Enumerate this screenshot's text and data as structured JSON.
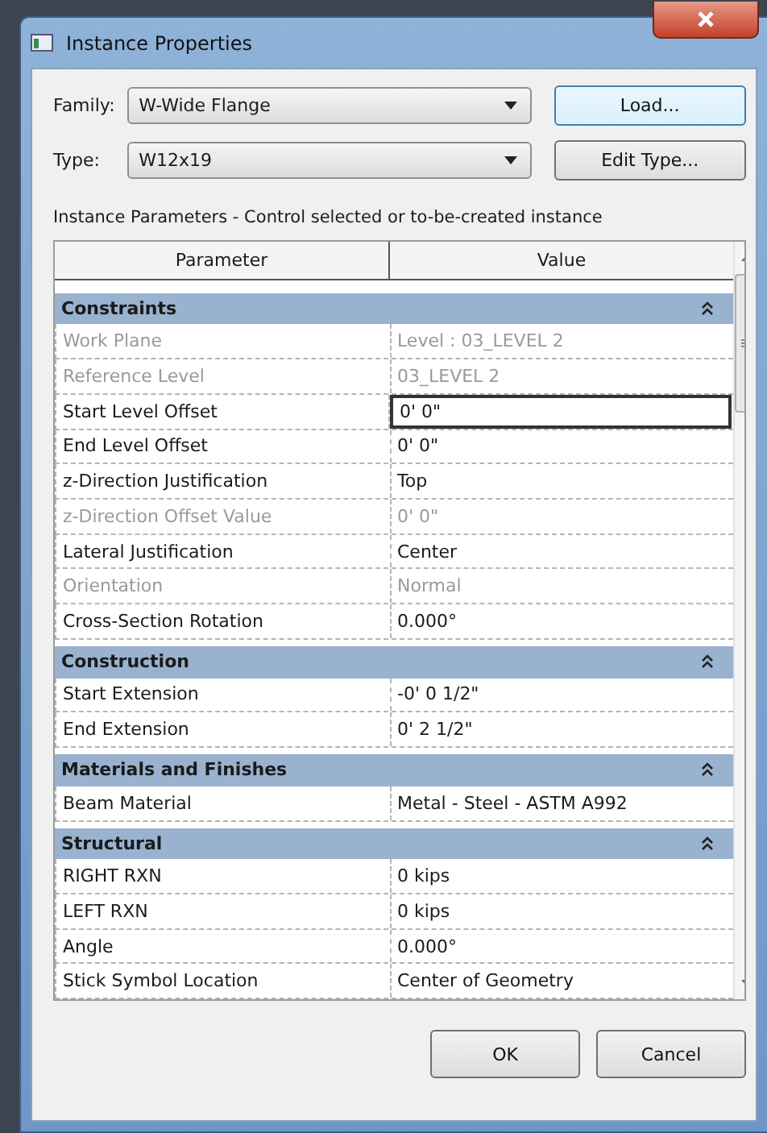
{
  "window": {
    "title": "Instance Properties"
  },
  "family": {
    "label": "Family:",
    "value": "W-Wide Flange"
  },
  "type": {
    "label": "Type:",
    "value": "W12x19"
  },
  "buttons_top": [
    "Load...",
    "Edit Type..."
  ],
  "caption": "Instance Parameters - Control selected or to-be-created instance",
  "table": {
    "columns": [
      "Parameter",
      "Value"
    ],
    "rows": [
      {
        "kind": "section",
        "label": "Constraints",
        "expanded": true
      },
      {
        "kind": "param",
        "name": "Work Plane",
        "value": "Level : 03_LEVEL 2",
        "disabled": true,
        "selected": false
      },
      {
        "kind": "param",
        "name": "Reference Level",
        "value": "03_LEVEL 2",
        "disabled": true,
        "selected": false
      },
      {
        "kind": "param",
        "name": "Start Level Offset",
        "value": "0'  0\"",
        "disabled": false,
        "selected": true
      },
      {
        "kind": "param",
        "name": "End Level Offset",
        "value": "0'  0\"",
        "disabled": false,
        "selected": false
      },
      {
        "kind": "param",
        "name": "z-Direction Justification",
        "value": "Top",
        "disabled": false,
        "selected": false
      },
      {
        "kind": "param",
        "name": "z-Direction Offset Value",
        "value": "0'  0\"",
        "disabled": true,
        "selected": false
      },
      {
        "kind": "param",
        "name": "Lateral Justification",
        "value": "Center",
        "disabled": false,
        "selected": false
      },
      {
        "kind": "param",
        "name": "Orientation",
        "value": "Normal",
        "disabled": true,
        "selected": false
      },
      {
        "kind": "param",
        "name": "Cross-Section Rotation",
        "value": "0.000°",
        "disabled": false,
        "selected": false
      },
      {
        "kind": "section",
        "label": "Construction",
        "expanded": true
      },
      {
        "kind": "param",
        "name": "Start Extension",
        "value": "-0'  0 1/2\"",
        "disabled": false,
        "selected": false
      },
      {
        "kind": "param",
        "name": "End Extension",
        "value": "0'  2 1/2\"",
        "disabled": false,
        "selected": false
      },
      {
        "kind": "section",
        "label": "Materials and Finishes",
        "expanded": true
      },
      {
        "kind": "param",
        "name": "Beam Material",
        "value": "Metal - Steel - ASTM A992",
        "disabled": false,
        "selected": false
      },
      {
        "kind": "section",
        "label": "Structural",
        "expanded": true
      },
      {
        "kind": "param",
        "name": "RIGHT RXN",
        "value": "0 kips",
        "disabled": false,
        "selected": false
      },
      {
        "kind": "param",
        "name": "LEFT RXN",
        "value": "0 kips",
        "disabled": false,
        "selected": false
      },
      {
        "kind": "param",
        "name": "Angle",
        "value": "0.000°",
        "disabled": false,
        "selected": false
      },
      {
        "kind": "param",
        "name": "Stick Symbol Location",
        "value": "Center of Geometry",
        "disabled": false,
        "selected": false
      }
    ]
  },
  "buttons": [
    "OK",
    "Cancel"
  ]
}
